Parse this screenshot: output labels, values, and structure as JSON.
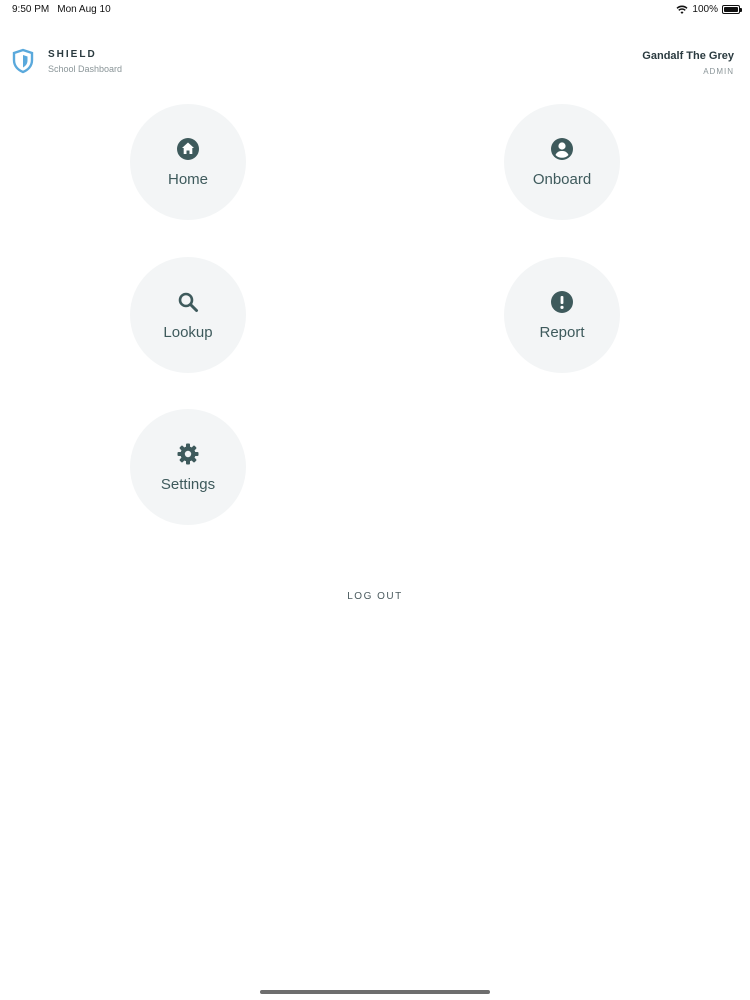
{
  "status_bar": {
    "time": "9:50 PM",
    "date": "Mon Aug 10",
    "battery_text": "100%",
    "battery_level": 1.0
  },
  "header": {
    "brand_title": "SHIELD",
    "brand_subtitle": "School Dashboard",
    "user_name": "Gandalf The Grey",
    "user_role": "ADMIN"
  },
  "menu": {
    "home": {
      "label": "Home",
      "icon": "home-icon"
    },
    "onboard": {
      "label": "Onboard",
      "icon": "account-circle-icon"
    },
    "lookup": {
      "label": "Lookup",
      "icon": "search-icon"
    },
    "report": {
      "label": "Report",
      "icon": "alert-icon"
    },
    "settings": {
      "label": "Settings",
      "icon": "gear-icon"
    }
  },
  "logout_label": "LOG OUT",
  "colors": {
    "icon": "#3e5a5c",
    "tile_bg": "#f3f5f6",
    "logo": "#5aa9dc"
  }
}
